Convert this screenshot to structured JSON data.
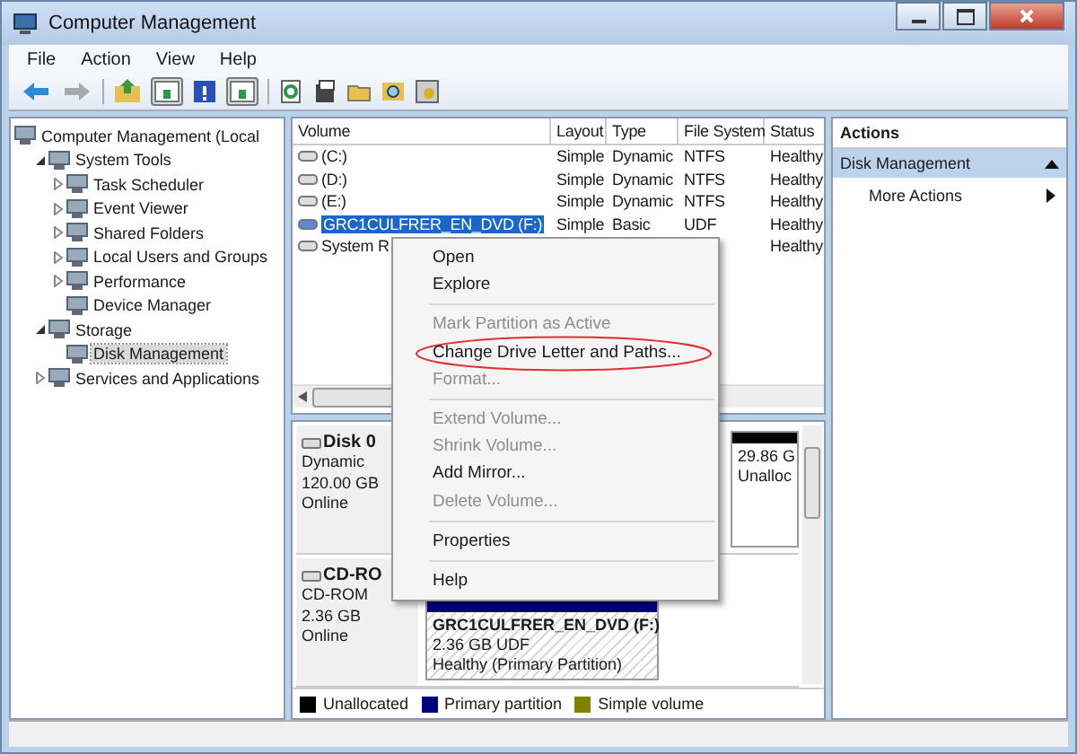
{
  "window": {
    "title": "Computer Management"
  },
  "menu": [
    "File",
    "Action",
    "View",
    "Help"
  ],
  "navigation": [
    {
      "kind": "back",
      "disabled": false
    },
    {
      "kind": "forward",
      "disabled": true
    }
  ],
  "tree": [
    {
      "label": "Computer Management (Local",
      "selected": false,
      "children": [
        {
          "label": "System Tools",
          "expanded": true,
          "selected": false,
          "children": [
            {
              "label": "Task Scheduler",
              "expanded": false,
              "selected": false
            },
            {
              "label": "Event Viewer",
              "expanded": false,
              "selected": false
            },
            {
              "label": "Shared Folders",
              "expanded": false,
              "selected": false
            },
            {
              "label": "Local Users and Groups",
              "expanded": false,
              "selected": false
            },
            {
              "label": "Performance",
              "expanded": false,
              "selected": false
            },
            {
              "label": "Device Manager",
              "selected": false
            }
          ]
        },
        {
          "label": "Storage",
          "expanded": true,
          "selected": false,
          "children": [
            {
              "label": "Disk Management",
              "selected": true
            }
          ]
        },
        {
          "label": "Services and Applications",
          "expanded": false,
          "selected": false
        }
      ]
    }
  ],
  "volumes": {
    "columns": [
      "Volume",
      "Layout",
      "Type",
      "File System",
      "Status"
    ],
    "rows": [
      {
        "volume": "(C:)",
        "layout": "Simple",
        "type": "Dynamic",
        "file_system": "NTFS",
        "status": "Healthy",
        "selected": false
      },
      {
        "volume": "(D:)",
        "layout": "Simple",
        "type": "Dynamic",
        "file_system": "NTFS",
        "status": "Healthy",
        "selected": false
      },
      {
        "volume": "(E:)",
        "layout": "Simple",
        "type": "Dynamic",
        "file_system": "NTFS",
        "status": "Healthy",
        "selected": false
      },
      {
        "volume": "GRC1CULFRER_EN_DVD (F:)",
        "layout": "Simple",
        "type": "Basic",
        "file_system": "UDF",
        "status": "Healthy",
        "selected": true
      },
      {
        "volume": "System R",
        "status": "Healthy",
        "selected": false
      }
    ]
  },
  "disks": [
    {
      "name": "Disk 0",
      "type": "Dynamic",
      "size": "120.00 GB",
      "status": "Online",
      "partitions": [
        {
          "kind": "unallocated",
          "lines": [
            "29.86 G",
            "Unalloc"
          ]
        }
      ]
    },
    {
      "name": "CD-RO",
      "type": "CD-ROM",
      "size": "2.36 GB",
      "status": "Online",
      "partitions": [
        {
          "kind": "primary",
          "name": "GRC1CULFRER_EN_DVD  (F:)",
          "lines": [
            "2.36 GB UDF",
            "Healthy (Primary Partition)"
          ]
        }
      ]
    }
  ],
  "legend": [
    {
      "label": "Unallocated",
      "color": "#000000"
    },
    {
      "label": "Primary partition",
      "color": "#00007f"
    },
    {
      "label": "Simple volume",
      "color": "#808000"
    }
  ],
  "actions": {
    "title": "Actions",
    "items": [
      {
        "kind": "header",
        "label": "Disk Management"
      },
      {
        "kind": "submenu",
        "label": "More Actions"
      }
    ]
  },
  "context_menu": [
    {
      "kind": "item",
      "label": "Open",
      "disabled": false,
      "circled": false
    },
    {
      "kind": "item",
      "label": "Explore",
      "disabled": false,
      "circled": false
    },
    {
      "kind": "separator"
    },
    {
      "kind": "item",
      "label": "Mark Partition as Active",
      "disabled": true,
      "circled": false
    },
    {
      "kind": "item",
      "label": "Change Drive Letter and Paths...",
      "disabled": false,
      "circled": true
    },
    {
      "kind": "item",
      "label": "Format...",
      "disabled": true,
      "circled": false
    },
    {
      "kind": "separator"
    },
    {
      "kind": "item",
      "label": "Extend Volume...",
      "disabled": true,
      "circled": false
    },
    {
      "kind": "item",
      "label": "Shrink Volume...",
      "disabled": true,
      "circled": false
    },
    {
      "kind": "item",
      "label": "Add Mirror...",
      "disabled": false,
      "circled": false
    },
    {
      "kind": "item",
      "label": "Delete Volume...",
      "disabled": true,
      "circled": false
    },
    {
      "kind": "separator"
    },
    {
      "kind": "item",
      "label": "Properties",
      "disabled": false,
      "circled": false
    },
    {
      "kind": "separator"
    },
    {
      "kind": "item",
      "label": "Help",
      "disabled": false,
      "circled": false
    }
  ]
}
